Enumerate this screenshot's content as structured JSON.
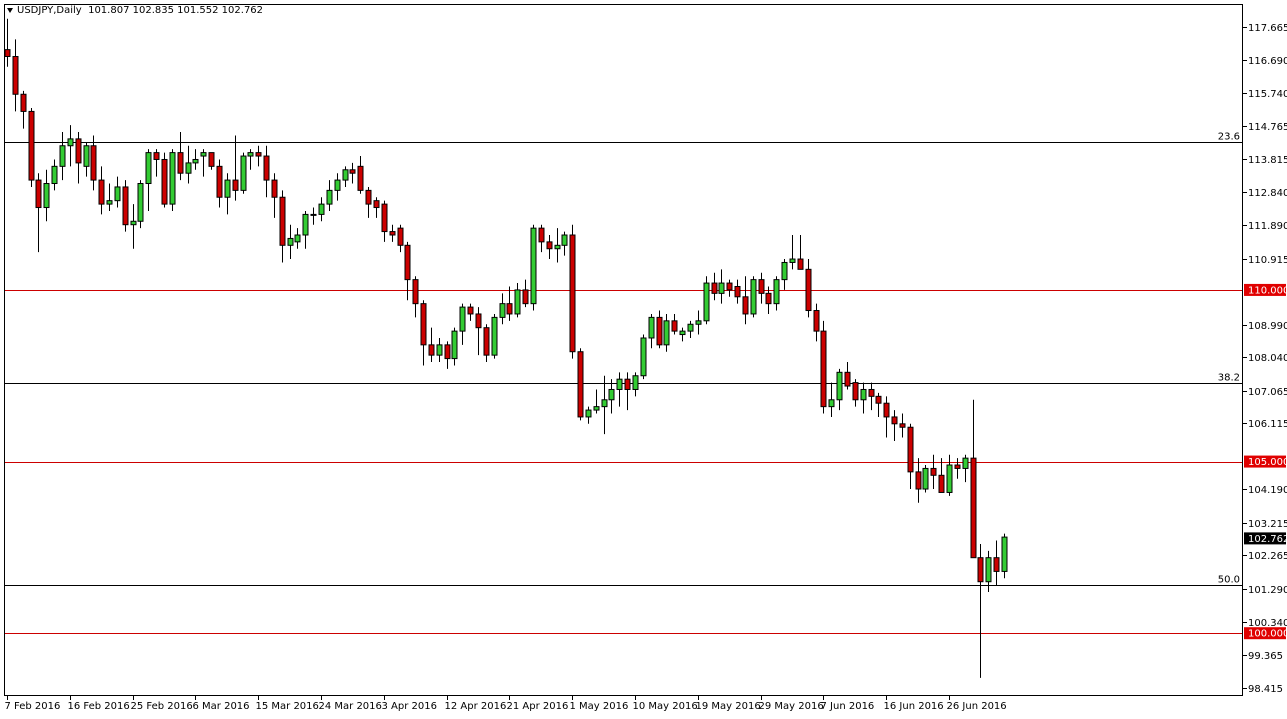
{
  "header": {
    "symbol": "USDJPY,Daily",
    "ohlc": "101.807 102.835 101.552 102.762"
  },
  "colors": {
    "bull": "#33cc33",
    "bear": "#cc0000",
    "wick": "#000000",
    "grid": "#000000",
    "level_red": "#cc0000",
    "badge_red": "#e00000",
    "badge_black": "#000000"
  },
  "chart_data": {
    "type": "candlestick",
    "title": "USDJPY,Daily",
    "ylim": [
      98.2,
      118.3
    ],
    "y_ticks": [
      "117.665",
      "116.690",
      "115.740",
      "114.765",
      "113.815",
      "112.840",
      "111.890",
      "110.915",
      "108.990",
      "108.040",
      "107.065",
      "106.115",
      "104.190",
      "103.215",
      "102.265",
      "101.290",
      "100.340",
      "99.365",
      "98.415"
    ],
    "x_labels": [
      "7 Feb 2016",
      "16 Feb 2016",
      "25 Feb 2016",
      "6 Mar 2016",
      "15 Mar 2016",
      "24 Mar 2016",
      "3 Apr 2016",
      "12 Apr 2016",
      "21 Apr 2016",
      "1 May 2016",
      "10 May 2016",
      "19 May 2016",
      "29 May 2016",
      "7 Jun 2016",
      "16 Jun 2016",
      "26 Jun 2016"
    ],
    "x_label_index": [
      0,
      8,
      16,
      24,
      32,
      40,
      48,
      56,
      64,
      72,
      80,
      88,
      96,
      104,
      112,
      120
    ],
    "black_levels": [
      {
        "value": 114.3,
        "label": "23.6"
      },
      {
        "value": 107.3,
        "label": "38.2"
      },
      {
        "value": 101.4,
        "label": "50.0"
      }
    ],
    "red_levels": [
      {
        "value": 110.0,
        "label": "110.000"
      },
      {
        "value": 105.0,
        "label": "105.000"
      },
      {
        "value": 100.0,
        "label": "100.000"
      }
    ],
    "current_price": {
      "value": 102.762,
      "label": "102.762"
    },
    "ohlc": [
      [
        117.0,
        117.9,
        116.5,
        116.8
      ],
      [
        116.8,
        117.3,
        115.2,
        115.7
      ],
      [
        115.7,
        115.8,
        114.7,
        115.2
      ],
      [
        115.2,
        115.3,
        113.0,
        113.2
      ],
      [
        113.2,
        113.4,
        111.1,
        112.4
      ],
      [
        112.4,
        113.5,
        112.0,
        113.1
      ],
      [
        113.1,
        113.8,
        112.9,
        113.6
      ],
      [
        113.6,
        114.6,
        113.2,
        114.2
      ],
      [
        114.2,
        114.8,
        113.6,
        114.4
      ],
      [
        114.4,
        114.6,
        113.1,
        113.7
      ],
      [
        113.6,
        114.3,
        113.3,
        114.2
      ],
      [
        114.2,
        114.5,
        112.9,
        113.2
      ],
      [
        113.2,
        113.6,
        112.2,
        112.5
      ],
      [
        112.5,
        113.1,
        112.3,
        112.6
      ],
      [
        112.6,
        113.3,
        112.4,
        113.0
      ],
      [
        113.0,
        113.2,
        111.7,
        111.9
      ],
      [
        111.9,
        112.5,
        111.2,
        112.0
      ],
      [
        112.0,
        113.2,
        111.8,
        113.1
      ],
      [
        113.1,
        114.1,
        112.3,
        114.0
      ],
      [
        114.0,
        114.1,
        113.3,
        113.8
      ],
      [
        113.8,
        114.0,
        112.4,
        112.5
      ],
      [
        112.5,
        114.1,
        112.3,
        114.0
      ],
      [
        114.0,
        114.6,
        113.2,
        113.4
      ],
      [
        113.4,
        114.2,
        113.1,
        113.7
      ],
      [
        113.7,
        114.1,
        113.5,
        113.8
      ],
      [
        113.9,
        114.1,
        113.3,
        114.0
      ],
      [
        114.0,
        114.0,
        113.5,
        113.6
      ],
      [
        113.6,
        113.8,
        112.4,
        112.7
      ],
      [
        112.7,
        113.4,
        112.2,
        113.2
      ],
      [
        113.2,
        114.5,
        112.6,
        112.9
      ],
      [
        112.9,
        114.0,
        112.8,
        113.9
      ],
      [
        113.9,
        114.1,
        113.5,
        114.0
      ],
      [
        114.0,
        114.2,
        113.6,
        113.9
      ],
      [
        113.9,
        114.2,
        112.7,
        113.2
      ],
      [
        113.2,
        113.4,
        112.1,
        112.7
      ],
      [
        112.7,
        112.9,
        110.8,
        111.3
      ],
      [
        111.3,
        111.9,
        110.9,
        111.5
      ],
      [
        111.4,
        111.8,
        111.2,
        111.6
      ],
      [
        111.6,
        112.3,
        111.2,
        112.2
      ],
      [
        112.2,
        112.4,
        111.9,
        112.2
      ],
      [
        112.2,
        112.7,
        112.0,
        112.5
      ],
      [
        112.5,
        113.2,
        112.3,
        112.9
      ],
      [
        112.9,
        113.4,
        112.6,
        113.2
      ],
      [
        113.2,
        113.6,
        113.0,
        113.5
      ],
      [
        113.5,
        113.7,
        113.1,
        113.4
      ],
      [
        113.6,
        113.9,
        112.8,
        112.9
      ],
      [
        112.9,
        113.0,
        112.1,
        112.5
      ],
      [
        112.6,
        112.7,
        112.1,
        112.4
      ],
      [
        112.5,
        112.6,
        111.4,
        111.7
      ],
      [
        111.7,
        111.9,
        111.4,
        111.6
      ],
      [
        111.8,
        111.9,
        111.1,
        111.3
      ],
      [
        111.3,
        111.4,
        109.7,
        110.3
      ],
      [
        110.3,
        110.4,
        109.2,
        109.6
      ],
      [
        109.6,
        109.7,
        107.8,
        108.4
      ],
      [
        108.4,
        108.9,
        107.9,
        108.1
      ],
      [
        108.1,
        108.6,
        107.9,
        108.4
      ],
      [
        108.4,
        108.5,
        107.7,
        108.0
      ],
      [
        108.0,
        108.9,
        107.8,
        108.8
      ],
      [
        108.8,
        109.6,
        108.4,
        109.5
      ],
      [
        109.5,
        109.6,
        109.1,
        109.3
      ],
      [
        109.3,
        109.5,
        108.1,
        108.9
      ],
      [
        108.9,
        109.0,
        107.9,
        108.1
      ],
      [
        108.1,
        109.3,
        108.0,
        109.2
      ],
      [
        109.2,
        109.9,
        109.0,
        109.6
      ],
      [
        109.6,
        110.1,
        109.1,
        109.3
      ],
      [
        109.3,
        110.2,
        109.2,
        110.0
      ],
      [
        110.0,
        110.3,
        109.5,
        109.6
      ],
      [
        109.6,
        111.9,
        109.4,
        111.8
      ],
      [
        111.8,
        111.9,
        111.1,
        111.4
      ],
      [
        111.4,
        111.6,
        110.9,
        111.2
      ],
      [
        111.2,
        111.8,
        110.8,
        111.3
      ],
      [
        111.3,
        111.7,
        111.0,
        111.6
      ],
      [
        111.6,
        111.9,
        108.0,
        108.2
      ],
      [
        108.2,
        108.3,
        106.2,
        106.3
      ],
      [
        106.3,
        106.6,
        106.1,
        106.5
      ],
      [
        106.5,
        107.1,
        106.4,
        106.6
      ],
      [
        106.6,
        107.5,
        105.8,
        106.8
      ],
      [
        106.8,
        107.4,
        106.4,
        107.1
      ],
      [
        107.1,
        107.6,
        106.6,
        107.4
      ],
      [
        107.4,
        107.6,
        106.5,
        107.1
      ],
      [
        107.1,
        107.6,
        106.9,
        107.5
      ],
      [
        107.5,
        108.7,
        107.4,
        108.6
      ],
      [
        108.6,
        109.3,
        108.3,
        109.2
      ],
      [
        109.2,
        109.4,
        108.3,
        108.4
      ],
      [
        108.4,
        109.3,
        108.2,
        109.1
      ],
      [
        109.1,
        109.3,
        108.7,
        108.8
      ],
      [
        108.7,
        108.9,
        108.5,
        108.8
      ],
      [
        108.8,
        109.1,
        108.6,
        109.0
      ],
      [
        109.0,
        109.4,
        108.7,
        109.1
      ],
      [
        109.1,
        110.4,
        109.0,
        110.2
      ],
      [
        110.2,
        110.5,
        109.7,
        109.9
      ],
      [
        109.9,
        110.6,
        109.6,
        110.2
      ],
      [
        110.2,
        110.3,
        109.8,
        110.0
      ],
      [
        110.1,
        110.3,
        109.6,
        109.8
      ],
      [
        109.8,
        110.4,
        109.0,
        109.3
      ],
      [
        109.3,
        110.4,
        109.2,
        110.3
      ],
      [
        110.3,
        110.5,
        109.6,
        109.9
      ],
      [
        109.9,
        110.1,
        109.3,
        109.6
      ],
      [
        109.6,
        110.4,
        109.4,
        110.3
      ],
      [
        110.3,
        110.9,
        110.0,
        110.8
      ],
      [
        110.8,
        111.6,
        110.6,
        110.9
      ],
      [
        110.9,
        111.6,
        110.6,
        110.6
      ],
      [
        110.6,
        110.9,
        109.2,
        109.4
      ],
      [
        109.4,
        109.6,
        108.5,
        108.8
      ],
      [
        108.8,
        109.1,
        106.4,
        106.6
      ],
      [
        106.6,
        107.3,
        106.3,
        106.8
      ],
      [
        106.8,
        107.7,
        106.5,
        107.6
      ],
      [
        107.6,
        107.9,
        107.1,
        107.2
      ],
      [
        107.3,
        107.4,
        106.6,
        106.8
      ],
      [
        106.8,
        107.3,
        106.4,
        107.1
      ],
      [
        107.1,
        107.3,
        106.5,
        106.9
      ],
      [
        106.9,
        107.0,
        106.3,
        106.7
      ],
      [
        106.7,
        106.9,
        105.7,
        106.3
      ],
      [
        106.3,
        106.5,
        105.6,
        106.1
      ],
      [
        106.1,
        106.4,
        105.7,
        106.0
      ],
      [
        106.0,
        106.1,
        104.2,
        104.7
      ],
      [
        104.7,
        105.1,
        103.8,
        104.2
      ],
      [
        104.2,
        104.9,
        104.1,
        104.8
      ],
      [
        104.8,
        105.2,
        104.2,
        104.6
      ],
      [
        104.6,
        105.1,
        104.1,
        104.1
      ],
      [
        104.1,
        105.2,
        104.0,
        104.9
      ],
      [
        104.9,
        105.1,
        104.5,
        104.8
      ],
      [
        104.8,
        105.2,
        104.4,
        105.1
      ],
      [
        105.1,
        106.8,
        103.1,
        102.2
      ],
      [
        102.2,
        102.6,
        98.7,
        101.5
      ],
      [
        101.5,
        102.4,
        101.2,
        102.2
      ],
      [
        102.2,
        102.7,
        101.4,
        101.8
      ],
      [
        101.8,
        102.9,
        101.6,
        102.8
      ]
    ]
  }
}
